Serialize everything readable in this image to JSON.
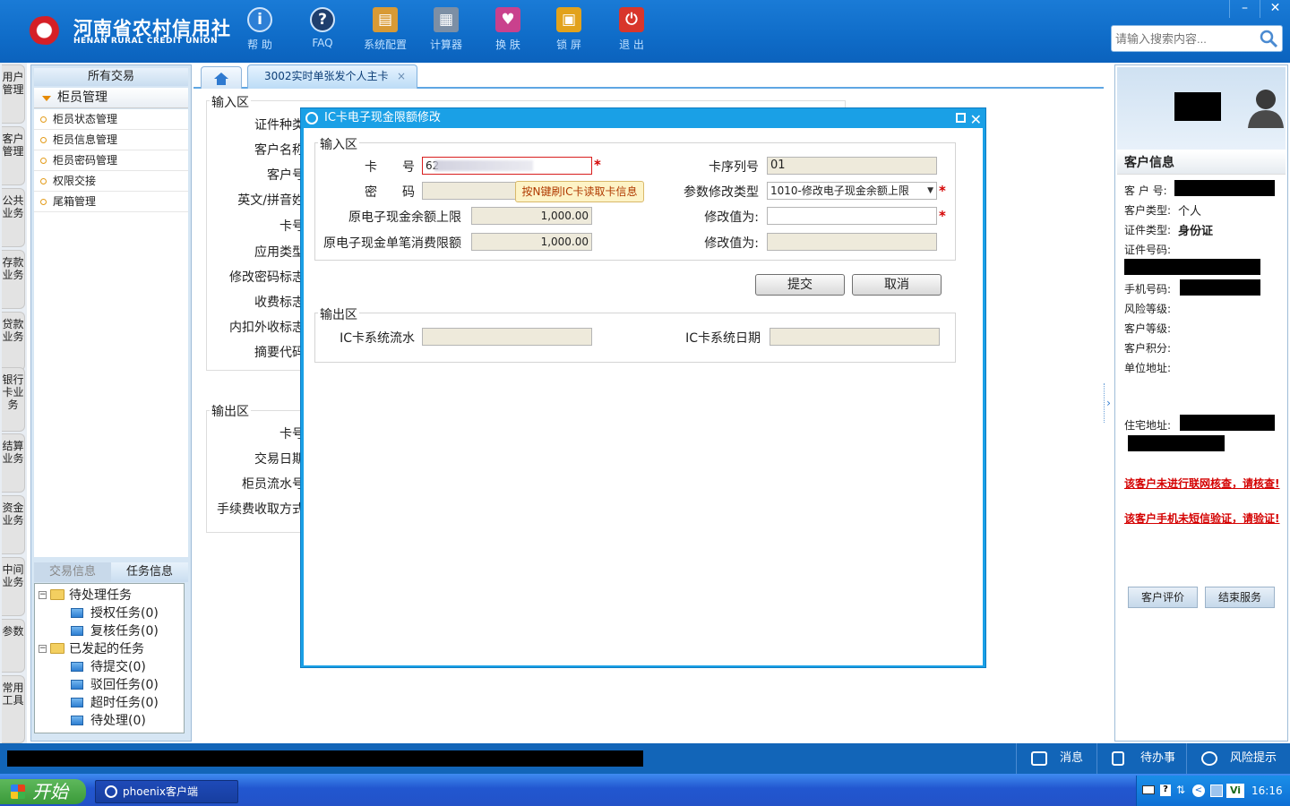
{
  "header": {
    "logo_cn": "河南省农村信用社",
    "logo_en": "HENAN RURAL CREDIT UNION",
    "tools": [
      {
        "label": "帮 助",
        "icon": "info-icon"
      },
      {
        "label": "FAQ",
        "icon": "help-icon"
      },
      {
        "label": "系统配置",
        "icon": "toolbox-icon"
      },
      {
        "label": "计算器",
        "icon": "calculator-icon"
      },
      {
        "label": "换 肤",
        "icon": "shirt-icon"
      },
      {
        "label": "锁 屏",
        "icon": "lock-icon"
      },
      {
        "label": "退 出",
        "icon": "power-icon"
      }
    ],
    "search_placeholder": "请输入搜索内容...",
    "minimize": "–",
    "close": "✕"
  },
  "vtabs": [
    "用户管理",
    "客户管理",
    "公共业务",
    "存款业务",
    "贷款业务",
    "银行卡业务",
    "结算业务",
    "资金业务",
    "中间业务",
    "参数",
    "常用工具"
  ],
  "sidebar": {
    "all_tx": "所有交易",
    "group": "柜员管理",
    "items": [
      "柜员状态管理",
      "柜员信息管理",
      "柜员密码管理",
      "权限交接",
      "尾箱管理"
    ],
    "bottom_tabs": [
      "交易信息",
      "任务信息"
    ],
    "tree": {
      "pending": "待处理任务",
      "auth": "授权任务(0)",
      "review": "复核任务(0)",
      "initiated": "已发起的任务",
      "to_submit": "待提交(0)",
      "rejected": "驳回任务(0)",
      "timeout": "超时任务(0)",
      "to_handle": "待处理(0)"
    }
  },
  "main": {
    "tab": "3002实时单张发个人主卡",
    "tab_close": "×",
    "input_area": "输入区",
    "output_area": "输出区",
    "input_labels": [
      "证件种类",
      "客户名称",
      "客户号",
      "英文/拼音姓",
      "卡号",
      "应用类型",
      "修改密码标志",
      "收费标志",
      "内扣外收标志",
      "摘要代码"
    ],
    "output_labels": [
      "卡号",
      "交易日期",
      "柜员流水号",
      "手续费收取方式"
    ]
  },
  "dialog": {
    "title": "IC卡电子现金限额修改",
    "input_legend": "输入区",
    "output_legend": "输出区",
    "card_no_label": "卡　　号",
    "card_no_value": "62",
    "password_label": "密　　码",
    "tooltip": "按N键刷IC卡读取卡信息",
    "orig_balance_label": "原电子现金余额上限",
    "orig_balance_value": "1,000.00",
    "orig_single_label": "原电子现金单笔消费限额",
    "orig_single_value": "1,000.00",
    "card_seq_label": "卡序列号",
    "card_seq_value": "01",
    "param_type_label": "参数修改类型",
    "param_type_value": "1010-修改电子现金余额上限",
    "modify_label": "修改值为:",
    "modify_label2": "修改值为:",
    "submit": "提交",
    "cancel": "取消",
    "ic_serial_label": "IC卡系统流水",
    "ic_date_label": "IC卡系统日期",
    "req": "*"
  },
  "customer": {
    "title": "客户信息",
    "cust_no_label": "客 户 号:",
    "cust_type_label": "客户类型:",
    "cust_type_value": "个人",
    "id_type_label": "证件类型:",
    "id_type_value": "身份证",
    "id_no_label": "证件号码:",
    "phone_label": "手机号码:",
    "risk_label": "风险等级:",
    "level_label": "客户等级:",
    "points_label": "客户积分:",
    "work_addr_label": "单位地址:",
    "home_addr_label": "住宅地址:",
    "warn1": "该客户未进行联网核查，请核查!",
    "warn2": "该客户手机未短信验证，请验证!",
    "btn_eval": "客户评价",
    "btn_end": "结束服务"
  },
  "statusbar": {
    "msg": "消息",
    "todo": "待办事项",
    "risk": "风险提示"
  },
  "taskbar": {
    "start": "开始",
    "window": "phoenix客户端",
    "clock": "16:16"
  }
}
